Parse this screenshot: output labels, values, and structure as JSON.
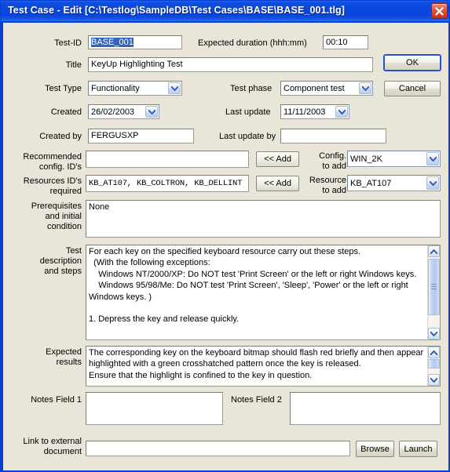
{
  "window": {
    "title": "Test Case - Edit [C:\\Testlog\\SampleDB\\Test Cases\\BASE\\BASE_001.tlg]",
    "close_label": "Close",
    "titlebar_color": "#0a46dd",
    "client_bg": "#e9e5d8",
    "selection_color": "#3066c0"
  },
  "buttons": {
    "ok": "OK",
    "cancel": "Cancel",
    "add_config": "<< Add",
    "add_resource": "<< Add",
    "browse": "Browse",
    "launch": "Launch"
  },
  "fields": {
    "test_id": {
      "label": "Test-ID",
      "value": "BASE_001",
      "selected": true
    },
    "expected_duration": {
      "label": "Expected duration (hhh:mm)",
      "value": "00:10"
    },
    "title": {
      "label": "Title",
      "value": "KeyUp Highlighting Test"
    },
    "test_type": {
      "label": "Test Type",
      "value": "Functionality"
    },
    "test_phase": {
      "label": "Test phase",
      "value": "Component test"
    },
    "created": {
      "label": "Created",
      "value": "26/02/2003"
    },
    "last_update": {
      "label": "Last update",
      "value": "11/11/2003"
    },
    "created_by": {
      "label": "Created by",
      "value": "FERGUSXP"
    },
    "last_update_by": {
      "label": "Last update by",
      "value": ""
    },
    "recommended_config_ids": {
      "label": "Recommended\nconfig. ID's",
      "value": ""
    },
    "config_to_add": {
      "label": "Config.\nto add",
      "value": "WIN_2K"
    },
    "resources_ids_required": {
      "label": "Resources ID's\nrequired",
      "value": "KB_AT107, KB_COLTRON, KB_DELLINT"
    },
    "resource_to_add": {
      "label": "Resource\nto add",
      "value": "KB_AT107"
    },
    "prerequisites": {
      "label": "Prerequisites\nand initial\ncondition",
      "value": "None"
    },
    "test_description": {
      "label": "Test\ndescription\nand steps",
      "value": "For each key on the specified keyboard resource carry out these steps.\n  (With the following exceptions:\n    Windows NT/2000/XP: Do NOT test 'Print Screen' or the left or right Windows keys.\n    Windows 95/98/Me: Do NOT test 'Print Screen', 'Sleep', 'Power' or the left or right\nWindows keys. )\n\n1. Depress the key and release quickly."
    },
    "expected_results": {
      "label": "Expected\nresults",
      "value": "The corresponding key on the keyboard bitmap should flash red briefly and then appear\nhighlighted with a green crosshatched pattern once the key is released.\nEnsure that the highlight is confined to the key in question."
    },
    "notes_field_1": {
      "label": "Notes Field 1",
      "value": ""
    },
    "notes_field_2": {
      "label": "Notes Field 2",
      "value": ""
    },
    "link_to_external_document": {
      "label": "Link to external\ndocument",
      "value": ""
    }
  }
}
